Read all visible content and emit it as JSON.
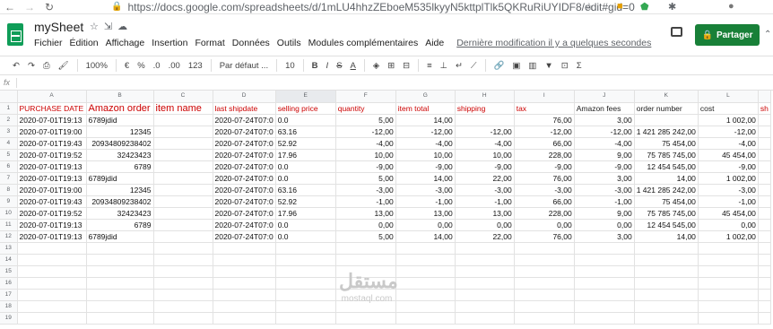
{
  "browser": {
    "url": "https://docs.google.com/spreadsheets/d/1mLU4hhzZEboeM535lkyyN5kttplTlk5QKRuRiUYIDF8/edit#gid=0"
  },
  "doc": {
    "title": "mySheet"
  },
  "menu": [
    "Fichier",
    "Édition",
    "Affichage",
    "Insertion",
    "Format",
    "Données",
    "Outils",
    "Modules complémentaires",
    "Aide"
  ],
  "last_modified": "Dernière modification il y a quelques secondes",
  "share_label": "Partager",
  "toolbar": {
    "zoom": "100%",
    "currency": "€",
    "percent": "%",
    "dec_minus": ".0",
    "dec_plus": ".00",
    "format123": "123",
    "font": "Par défaut ...",
    "size": "10"
  },
  "fx": "fx",
  "columns": [
    "A",
    "B",
    "C",
    "D",
    "E",
    "F",
    "G",
    "H",
    "I",
    "J",
    "K",
    "L"
  ],
  "header_row": [
    "PURCHASE DATE",
    "Amazon order",
    "item name",
    "last shipdate",
    "selling price",
    "quantity",
    "item total",
    "shipping",
    "tax",
    "Amazon fees",
    "order number",
    "cost",
    "sh"
  ],
  "rows": [
    [
      "2020-07-01T19:13",
      "6789jdid",
      "",
      "2020-07-24T07:0",
      "0.0",
      "5,00",
      "14,00",
      "",
      "76,00",
      "3,00",
      "",
      "1 002,00"
    ],
    [
      "2020-07-01T19:00",
      "12345",
      "",
      "2020-07-24T07:0",
      "63.16",
      "-12,00",
      "-12,00",
      "-12,00",
      "-12,00",
      "-12,00",
      "1 421 285 242,00",
      "-12,00"
    ],
    [
      "2020-07-01T19:43",
      "20934809238402",
      "",
      "2020-07-24T07:0",
      "52.92",
      "-4,00",
      "-4,00",
      "-4,00",
      "66,00",
      "-4,00",
      "75 454,00",
      "-4,00"
    ],
    [
      "2020-07-01T19:52",
      "32423423",
      "",
      "2020-07-24T07:0",
      "17.96",
      "10,00",
      "10,00",
      "10,00",
      "228,00",
      "9,00",
      "75 785 745,00",
      "45 454,00"
    ],
    [
      "2020-07-01T19:13",
      "6789",
      "",
      "2020-07-24T07:0",
      "0.0",
      "-9,00",
      "-9,00",
      "-9,00",
      "-9,00",
      "-9,00",
      "12 454 545,00",
      "-9,00"
    ],
    [
      "2020-07-01T19:13",
      "6789jdid",
      "",
      "2020-07-24T07:0",
      "0.0",
      "5,00",
      "14,00",
      "22,00",
      "76,00",
      "3,00",
      "14,00",
      "1 002,00"
    ],
    [
      "2020-07-01T19:00",
      "12345",
      "",
      "2020-07-24T07:0",
      "63.16",
      "-3,00",
      "-3,00",
      "-3,00",
      "-3,00",
      "-3,00",
      "1 421 285 242,00",
      "-3,00"
    ],
    [
      "2020-07-01T19:43",
      "20934809238402",
      "",
      "2020-07-24T07:0",
      "52.92",
      "-1,00",
      "-1,00",
      "-1,00",
      "66,00",
      "-1,00",
      "75 454,00",
      "-1,00"
    ],
    [
      "2020-07-01T19:52",
      "32423423",
      "",
      "2020-07-24T07:0",
      "17.96",
      "13,00",
      "13,00",
      "13,00",
      "228,00",
      "9,00",
      "75 785 745,00",
      "45 454,00"
    ],
    [
      "2020-07-01T19:13",
      "6789",
      "",
      "2020-07-24T07:0",
      "0.0",
      "0,00",
      "0,00",
      "0,00",
      "0,00",
      "0,00",
      "12 454 545,00",
      "0,00"
    ],
    [
      "2020-07-01T19:13",
      "6789jdid",
      "",
      "2020-07-24T07:0",
      "0.0",
      "5,00",
      "14,00",
      "22,00",
      "76,00",
      "3,00",
      "14,00",
      "1 002,00"
    ]
  ],
  "row_numbers": [
    "1",
    "2",
    "3",
    "4",
    "5",
    "6",
    "7",
    "8",
    "9",
    "10",
    "11",
    "12",
    "13",
    "14",
    "15",
    "16",
    "17",
    "18",
    "19"
  ],
  "watermark": {
    "line1": "مستقل",
    "line2": "mostaql.com"
  }
}
